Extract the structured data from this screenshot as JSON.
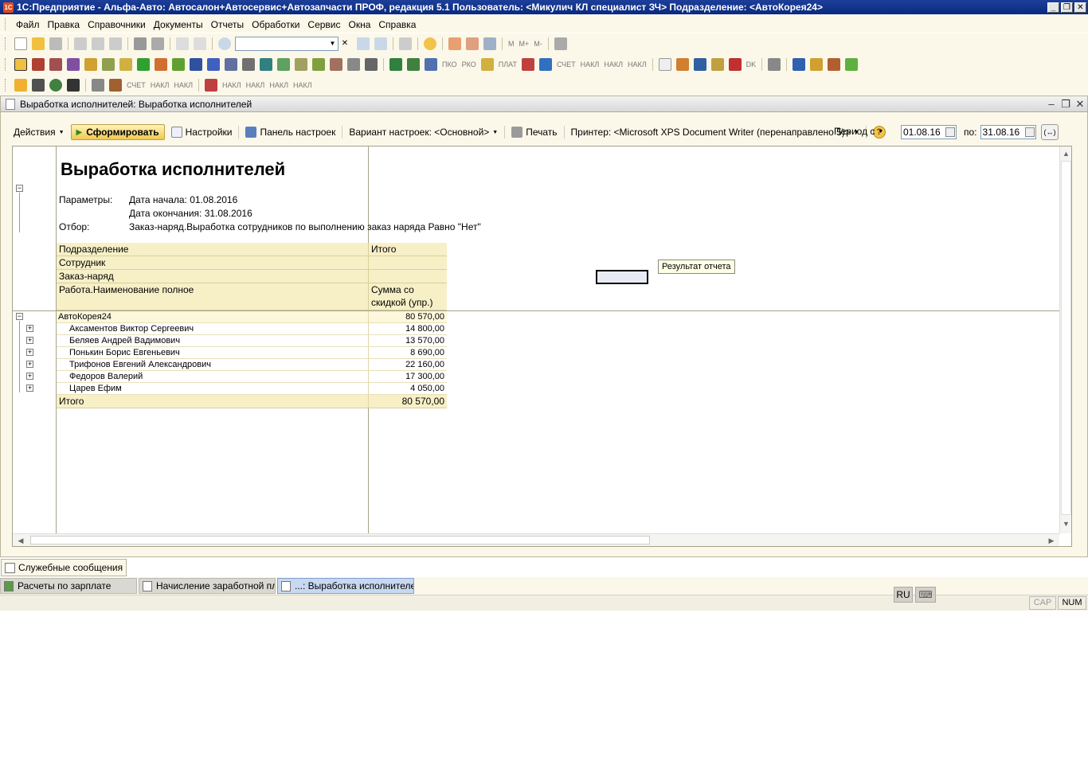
{
  "window": {
    "title": "1С:Предприятие - Альфа-Авто: Автосалон+Автосервис+Автозапчасти ПРОФ, редакция 5.1    Пользователь: <Микулич КЛ специалист ЗЧ>    Подразделение: <АвтоКорея24>",
    "app_icon_text": "1C"
  },
  "menu": [
    "Файл",
    "Правка",
    "Справочники",
    "Документы",
    "Отчеты",
    "Обработки",
    "Сервис",
    "Окна",
    "Справка"
  ],
  "toolbar": {
    "memory_labels": [
      "M",
      "M+",
      "M-"
    ],
    "doc_labels": [
      "ПКО",
      "РКО",
      "ПЛАТ",
      "СЧЕТ",
      "НАКЛ",
      "НАКЛ",
      "НАКЛ",
      "СЧЕТ",
      "НАКЛ",
      "НАКЛ",
      "НАКЛ",
      "НАКЛ",
      "НАКЛ",
      "НАКЛ"
    ],
    "dk_label": "DK",
    "search_value": ""
  },
  "document": {
    "title": "Выработка исполнителей: Выработка исполнителей",
    "commands": {
      "actions": "Действия",
      "generate": "Сформировать",
      "settings": "Настройки",
      "settings_panel": "Панель настроек",
      "variant": "Вариант настроек: <Основной>",
      "print": "Печать",
      "printer": "Принтер: <Microsoft XPS Document Writer (перенаправлено 5)>",
      "help": "?",
      "period_from_label": "Период с",
      "period_from": "01.08.16",
      "period_to_label": "по:",
      "period_to": "31.08.16",
      "extra": "(↔)"
    }
  },
  "report": {
    "heading": "Выработка исполнителей",
    "params_label": "Параметры:",
    "date_start": "Дата начала: 01.08.2016",
    "date_end": "Дата окончания: 31.08.2016",
    "filter_label": "Отбор:",
    "filter_value": "Заказ-наряд.Выработка сотрудников по выполнению заказ наряда Равно \"Нет\"",
    "headers": {
      "division": "Подразделение",
      "total_col": "Итого",
      "employee": "Сотрудник",
      "order": "Заказ-наряд",
      "work": "Работа.Наименование полное",
      "sum_line1": "Сумма со",
      "sum_line2": "скидкой (упр.)"
    },
    "group": {
      "name": "АвтоКорея24",
      "value": "80 570,00"
    },
    "rows": [
      {
        "name": "Аксаментов Виктор Сергеевич",
        "value": "14 800,00"
      },
      {
        "name": "Беляев Андрей Вадимович",
        "value": "13 570,00"
      },
      {
        "name": "Понькин Борис Евгеньевич",
        "value": "8 690,00"
      },
      {
        "name": "Трифонов Евгений Александрович",
        "value": "22 160,00"
      },
      {
        "name": "Федоров Валерий",
        "value": "17 300,00"
      },
      {
        "name": "Царев Ефим",
        "value": "4 050,00"
      }
    ],
    "total": {
      "label": "Итого",
      "value": "80 570,00"
    },
    "tooltip": "Результат отчета"
  },
  "panels": {
    "service_messages": "Служебные сообщения",
    "tasks": [
      {
        "label": "Расчеты по зарплате",
        "active": false
      },
      {
        "label": "Начисление заработной пл...",
        "active": false
      },
      {
        "label": "...: Выработка исполнителей",
        "active": true
      }
    ]
  },
  "status": {
    "lang": "RU",
    "cap": "CAP",
    "num": "NUM"
  }
}
